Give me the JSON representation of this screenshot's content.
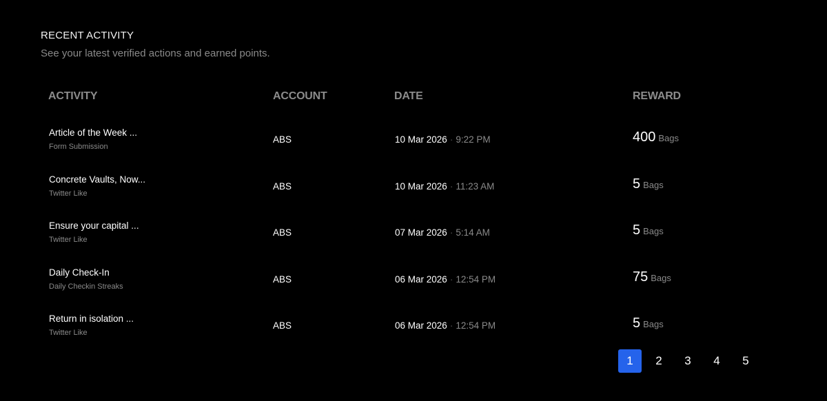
{
  "section": {
    "title": "RECENT ACTIVITY",
    "subtitle": "See your latest verified actions and earned points."
  },
  "table": {
    "headers": {
      "activity": "ACTIVITY",
      "account": "ACCOUNT",
      "date": "DATE",
      "reward": "REWARD"
    },
    "rows": [
      {
        "title": "Article of the Week ...",
        "type": "Form Submission",
        "account": "ABS",
        "date": "10 Mar 2026",
        "separator": "·",
        "time": "9:22 PM",
        "reward": "400",
        "unit": "Bags"
      },
      {
        "title": "Concrete Vaults, Now...",
        "type": "Twitter Like",
        "account": "ABS",
        "date": "10 Mar 2026",
        "separator": "·",
        "time": "11:23 AM",
        "reward": "5",
        "unit": "Bags"
      },
      {
        "title": "Ensure your capital ...",
        "type": "Twitter Like",
        "account": "ABS",
        "date": "07 Mar 2026",
        "separator": "·",
        "time": "5:14 AM",
        "reward": "5",
        "unit": "Bags"
      },
      {
        "title": "Daily Check-In",
        "type": "Daily Checkin Streaks",
        "account": "ABS",
        "date": "06 Mar 2026",
        "separator": "·",
        "time": "12:54 PM",
        "reward": "75",
        "unit": "Bags"
      },
      {
        "title": "Return in isolation ...",
        "type": "Twitter Like",
        "account": "ABS",
        "date": "06 Mar 2026",
        "separator": "·",
        "time": "12:54 PM",
        "reward": "5",
        "unit": "Bags"
      }
    ]
  },
  "pagination": {
    "pages": [
      "1",
      "2",
      "3",
      "4",
      "5"
    ],
    "current": "1"
  },
  "colors": {
    "background": "#000000",
    "accent": "#2563eb",
    "muted_text": "#8a8a8a"
  }
}
